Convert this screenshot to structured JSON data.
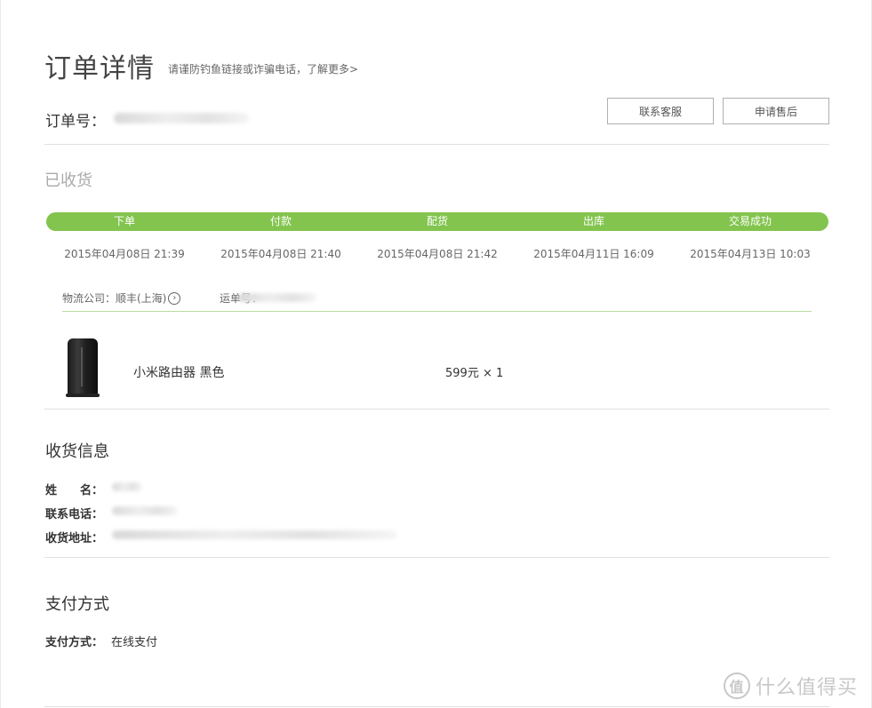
{
  "header": {
    "title": "订单详情",
    "warning": "请谨防钓鱼链接或诈骗电话，了解更多>",
    "order_no_label": "订单号：",
    "contact_button": "联系客服",
    "after_sale_button": "申请售后"
  },
  "status": {
    "text": "已收货",
    "steps": [
      {
        "label": "下单",
        "time": "2015年04月08日 21:39"
      },
      {
        "label": "付款",
        "time": "2015年04月08日 21:40"
      },
      {
        "label": "配货",
        "time": "2015年04月08日 21:42"
      },
      {
        "label": "出库",
        "time": "2015年04月11日 16:09"
      },
      {
        "label": "交易成功",
        "time": "2015年04月13日 10:03"
      }
    ],
    "progress_fraction": 1.0,
    "accent_color": "#83c44e"
  },
  "logistics": {
    "company_label": "物流公司：顺丰(上海)",
    "company_icon": "arrow-right-circle-icon",
    "waybill_label": "运单号："
  },
  "product": {
    "name": "小米路由器 黑色",
    "price": "599元 × 1"
  },
  "shipping": {
    "title": "收货信息",
    "name_label": "姓　　名：",
    "phone_label": "联系电话：",
    "address_label": "收货地址："
  },
  "payment": {
    "title": "支付方式",
    "method_label": "支付方式：",
    "method_value": "在线支付"
  },
  "watermark": {
    "text": "什么值得买",
    "icon": "值"
  }
}
